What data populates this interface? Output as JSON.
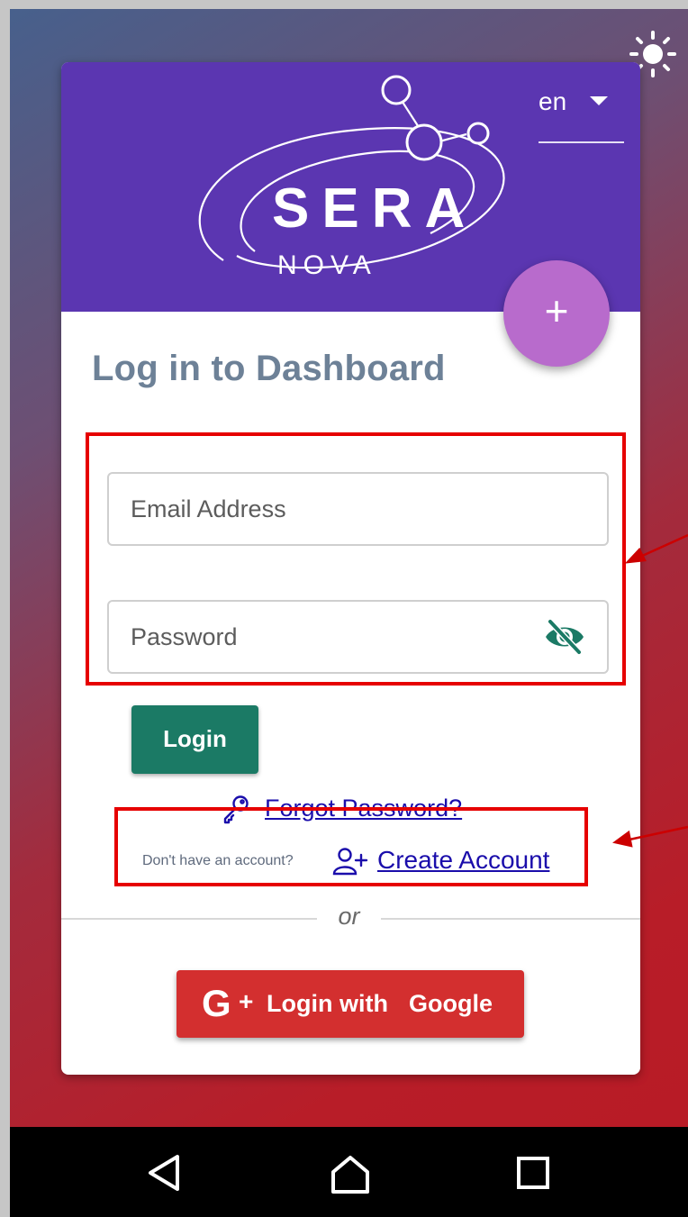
{
  "header": {
    "brand_top": "SERA",
    "brand_bottom": "NOVA",
    "language": "en",
    "fab_label": "+",
    "brand_color": "#5b36b1",
    "fab_color": "#b86bcc"
  },
  "login_form": {
    "title": "Log in to Dashboard",
    "email_placeholder": "Email Address",
    "email_value": "",
    "password_placeholder": "Password",
    "password_value": "",
    "password_toggle_icon": "eye-off-icon",
    "login_label": "Login",
    "login_color": "#1b7a65",
    "forgot_label": "Forgot Password?",
    "forgot_icon": "key-icon"
  },
  "signup": {
    "prompt": "Don't have an account?",
    "icon": "user-plus-icon",
    "link_label": "Create Account"
  },
  "divider": {
    "label": "or"
  },
  "social": {
    "google_g": "G",
    "google_plus": "+",
    "label_prefix": "Login with",
    "label_brand": "Google",
    "color": "#d32f2f"
  },
  "system": {
    "theme_icon": "sun-icon",
    "nav_icons": [
      "back-icon",
      "home-icon",
      "recents-icon"
    ]
  },
  "annotations": {
    "color": "#e60000"
  }
}
